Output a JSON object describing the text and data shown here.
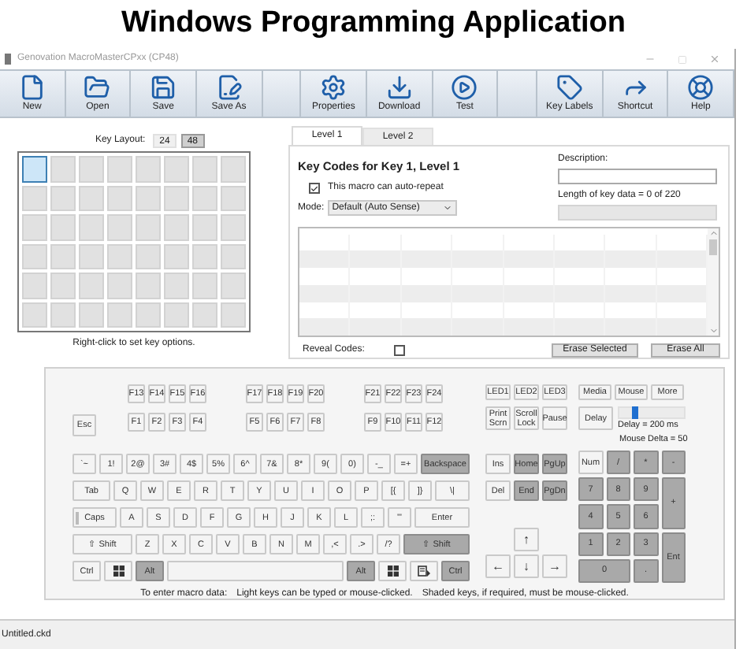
{
  "heading": "Windows Programming Application",
  "window": {
    "title": "Genovation MacroMasterCPxx (CP48)"
  },
  "toolbar": {
    "groups": [
      [
        {
          "kind": "new",
          "label": "New"
        },
        {
          "kind": "open",
          "label": "Open"
        },
        {
          "kind": "save",
          "label": "Save"
        },
        {
          "kind": "save_as",
          "label": "Save As"
        }
      ],
      [
        {
          "kind": "properties",
          "label": "Properties"
        },
        {
          "kind": "download",
          "label": "Download"
        },
        {
          "kind": "test",
          "label": "Test"
        }
      ],
      [
        {
          "kind": "key_labels",
          "label": "Key Labels"
        },
        {
          "kind": "shortcut",
          "label": "Shortcut"
        },
        {
          "kind": "help",
          "label": "Help"
        }
      ]
    ]
  },
  "key_layout": {
    "label": "Key Layout:",
    "options": [
      {
        "label": "24",
        "selected": false
      },
      {
        "label": "48",
        "selected": true
      }
    ]
  },
  "key_grid": {
    "rows": [
      [
        {
          "selected": true
        },
        {
          "selected": false
        },
        {
          "selected": false
        },
        {
          "selected": false
        },
        {
          "selected": false
        },
        {
          "selected": false
        },
        {
          "selected": false
        },
        {
          "selected": false
        }
      ],
      [
        {
          "selected": false
        },
        {
          "selected": false
        },
        {
          "selected": false
        },
        {
          "selected": false
        },
        {
          "selected": false
        },
        {
          "selected": false
        },
        {
          "selected": false
        },
        {
          "selected": false
        }
      ],
      [
        {
          "selected": false
        },
        {
          "selected": false
        },
        {
          "selected": false
        },
        {
          "selected": false
        },
        {
          "selected": false
        },
        {
          "selected": false
        },
        {
          "selected": false
        },
        {
          "selected": false
        }
      ],
      [
        {
          "selected": false
        },
        {
          "selected": false
        },
        {
          "selected": false
        },
        {
          "selected": false
        },
        {
          "selected": false
        },
        {
          "selected": false
        },
        {
          "selected": false
        },
        {
          "selected": false
        }
      ],
      [
        {
          "selected": false
        },
        {
          "selected": false
        },
        {
          "selected": false
        },
        {
          "selected": false
        },
        {
          "selected": false
        },
        {
          "selected": false
        },
        {
          "selected": false
        },
        {
          "selected": false
        }
      ],
      [
        {
          "selected": false
        },
        {
          "selected": false
        },
        {
          "selected": false
        },
        {
          "selected": false
        },
        {
          "selected": false
        },
        {
          "selected": false
        },
        {
          "selected": false
        },
        {
          "selected": false
        }
      ]
    ],
    "hint": "Right-click to set key options."
  },
  "tabs": [
    {
      "label": "Level 1",
      "selected": true
    },
    {
      "label": "Level 2",
      "selected": false
    }
  ],
  "key_codes": {
    "title": "Key Codes for Key 1, Level 1",
    "auto_repeat": {
      "label": "This macro can auto-repeat",
      "checked": true
    },
    "mode": {
      "label": "Mode:",
      "value": "Default (Auto Sense)"
    },
    "description": {
      "label": "Description:"
    },
    "length": "Length of key data = 0 of 220",
    "reveal_codes": {
      "label": "Reveal Codes:",
      "checked": false
    },
    "buttons": [
      "Erase Selected",
      "Erase All"
    ]
  },
  "keyboard": {
    "esc": {
      "label": "Esc",
      "shaded": false
    },
    "function_rows": [
      [
        [
          {
            "label": "F13",
            "shaded": false
          },
          {
            "label": "F14",
            "shaded": false
          },
          {
            "label": "F15",
            "shaded": false
          },
          {
            "label": "F16",
            "shaded": false
          }
        ],
        [
          {
            "label": "F17",
            "shaded": false
          },
          {
            "label": "F18",
            "shaded": false
          },
          {
            "label": "F19",
            "shaded": false
          },
          {
            "label": "F20",
            "shaded": false
          }
        ],
        [
          {
            "label": "F21",
            "shaded": false
          },
          {
            "label": "F22",
            "shaded": false
          },
          {
            "label": "F23",
            "shaded": false
          },
          {
            "label": "F24",
            "shaded": false
          }
        ]
      ],
      [
        [
          {
            "label": "F1",
            "shaded": false
          },
          {
            "label": "F2",
            "shaded": false
          },
          {
            "label": "F3",
            "shaded": false
          },
          {
            "label": "F4",
            "shaded": false
          }
        ],
        [
          {
            "label": "F5",
            "shaded": false
          },
          {
            "label": "F6",
            "shaded": false
          },
          {
            "label": "F7",
            "shaded": false
          },
          {
            "label": "F8",
            "shaded": false
          }
        ],
        [
          {
            "label": "F9",
            "shaded": false
          },
          {
            "label": "F10",
            "shaded": false
          },
          {
            "label": "F11",
            "shaded": false
          },
          {
            "label": "F12",
            "shaded": false
          }
        ]
      ]
    ],
    "main_rows": [
      [
        {
          "kind": "std",
          "label": "`~",
          "shaded": false
        },
        {
          "kind": "std",
          "label": "1!",
          "shaded": false
        },
        {
          "kind": "std",
          "label": "2@",
          "shaded": false
        },
        {
          "kind": "std",
          "label": "3#",
          "shaded": false
        },
        {
          "kind": "std",
          "label": "4$",
          "shaded": false
        },
        {
          "kind": "std",
          "label": "5%",
          "shaded": false
        },
        {
          "kind": "std",
          "label": "6^",
          "shaded": false
        },
        {
          "kind": "std",
          "label": "7&",
          "shaded": false
        },
        {
          "kind": "std",
          "label": "8*",
          "shaded": false
        },
        {
          "kind": "std",
          "label": "9(",
          "shaded": false
        },
        {
          "kind": "std",
          "label": "0)",
          "shaded": false
        },
        {
          "kind": "std",
          "label": "-_",
          "shaded": false
        },
        {
          "kind": "std",
          "label": "=+",
          "shaded": false
        },
        {
          "kind": "fill",
          "label": "Backspace",
          "shaded": true
        }
      ],
      [
        {
          "kind": "tab",
          "label": "Tab",
          "shaded": false
        },
        {
          "kind": "std",
          "label": "Q",
          "shaded": false
        },
        {
          "kind": "std",
          "label": "W",
          "shaded": false
        },
        {
          "kind": "std",
          "label": "E",
          "shaded": false
        },
        {
          "kind": "std",
          "label": "R",
          "shaded": false
        },
        {
          "kind": "std",
          "label": "T",
          "shaded": false
        },
        {
          "kind": "std",
          "label": "Y",
          "shaded": false
        },
        {
          "kind": "std",
          "label": "U",
          "shaded": false
        },
        {
          "kind": "std",
          "label": "I",
          "shaded": false
        },
        {
          "kind": "std",
          "label": "O",
          "shaded": false
        },
        {
          "kind": "std",
          "label": "P",
          "shaded": false
        },
        {
          "kind": "std",
          "label": "[{",
          "shaded": false
        },
        {
          "kind": "std",
          "label": "]}",
          "shaded": false
        },
        {
          "kind": "fill",
          "label": "\\|",
          "shaded": false
        }
      ],
      [
        {
          "kind": "caps",
          "label": "Caps",
          "shaded": false
        },
        {
          "kind": "std",
          "label": "A",
          "shaded": false
        },
        {
          "kind": "std",
          "label": "S",
          "shaded": false
        },
        {
          "kind": "std",
          "label": "D",
          "shaded": false
        },
        {
          "kind": "std",
          "label": "F",
          "shaded": false
        },
        {
          "kind": "std",
          "label": "G",
          "shaded": false
        },
        {
          "kind": "std",
          "label": "H",
          "shaded": false
        },
        {
          "kind": "std",
          "label": "J",
          "shaded": false
        },
        {
          "kind": "std",
          "label": "K",
          "shaded": false
        },
        {
          "kind": "std",
          "label": "L",
          "shaded": false
        },
        {
          "kind": "std",
          "label": ";:",
          "shaded": false
        },
        {
          "kind": "std",
          "label": "'\"",
          "shaded": false
        },
        {
          "kind": "fill",
          "label": "Enter",
          "shaded": false
        }
      ],
      [
        {
          "kind": "lshift",
          "label": "⇧ Shift",
          "shaded": false
        },
        {
          "kind": "std",
          "label": "Z",
          "shaded": false
        },
        {
          "kind": "std",
          "label": "X",
          "shaded": false
        },
        {
          "kind": "std",
          "label": "C",
          "shaded": false
        },
        {
          "kind": "std",
          "label": "V",
          "shaded": false
        },
        {
          "kind": "std",
          "label": "B",
          "shaded": false
        },
        {
          "kind": "std",
          "label": "N",
          "shaded": false
        },
        {
          "kind": "std",
          "label": "M",
          "shaded": false
        },
        {
          "kind": "std",
          "label": ",<",
          "shaded": false
        },
        {
          "kind": "std",
          "label": ".>",
          "shaded": false
        },
        {
          "kind": "std",
          "label": "/?",
          "shaded": false
        },
        {
          "kind": "fill",
          "label": "⇧ Shift",
          "shaded": true
        }
      ],
      [
        {
          "kind": "mod",
          "label": "Ctrl",
          "shaded": false
        },
        {
          "kind": "win",
          "shaded": false
        },
        {
          "kind": "mod",
          "label": "Alt",
          "shaded": true
        },
        {
          "kind": "space",
          "shaded": false
        },
        {
          "kind": "mod",
          "label": "Alt",
          "shaded": true
        },
        {
          "kind": "win",
          "shaded": false
        },
        {
          "kind": "menu",
          "shaded": false
        },
        {
          "kind": "mod",
          "label": "Ctrl",
          "shaded": true
        }
      ]
    ],
    "leds": [
      {
        "label": "LED1",
        "shaded": false
      },
      {
        "label": "LED2",
        "shaded": false
      },
      {
        "label": "LED3",
        "shaded": false
      }
    ],
    "system_keys": [
      {
        "label": "Print Scrn",
        "shaded": false
      },
      {
        "label": "Scroll Lock",
        "shaded": false
      },
      {
        "label": "Pause",
        "shaded": false
      }
    ],
    "nav_keys": [
      {
        "label": "Ins",
        "shaded": false
      },
      {
        "label": "Home",
        "shaded": true
      },
      {
        "label": "PgUp",
        "shaded": true
      },
      {
        "label": "Del",
        "shaded": false
      },
      {
        "label": "End",
        "shaded": true
      },
      {
        "label": "PgDn",
        "shaded": true
      }
    ],
    "arrow_keys": [
      {
        "label": "↑",
        "shaded": false
      },
      {
        "label": "←",
        "shaded": false
      },
      {
        "label": "↓",
        "shaded": false
      },
      {
        "label": "→",
        "shaded": false
      }
    ],
    "mode_buttons": [
      "Media",
      "Mouse",
      "More"
    ],
    "delay": {
      "label": "Delay",
      "level": 0.25,
      "reading": "Delay = 200 ms",
      "mouse_reading": "Mouse Delta = 50"
    },
    "numpad": [
      {
        "kind": "std",
        "label": "Num",
        "shaded": false
      },
      {
        "kind": "std",
        "label": "/",
        "shaded": true
      },
      {
        "kind": "std",
        "label": "*",
        "shaded": true
      },
      {
        "kind": "std",
        "label": "-",
        "shaded": true
      },
      {
        "kind": "std",
        "label": "7",
        "shaded": true
      },
      {
        "kind": "std",
        "label": "8",
        "shaded": true
      },
      {
        "kind": "std",
        "label": "9",
        "shaded": true
      },
      {
        "kind": "tall",
        "label": "+",
        "shaded": true
      },
      {
        "kind": "std",
        "label": "4",
        "shaded": true
      },
      {
        "kind": "std",
        "label": "5",
        "shaded": true
      },
      {
        "kind": "std",
        "label": "6",
        "shaded": true
      },
      {
        "kind": "std",
        "label": "1",
        "shaded": true
      },
      {
        "kind": "std",
        "label": "2",
        "shaded": true
      },
      {
        "kind": "std",
        "label": "3",
        "shaded": true
      },
      {
        "kind": "tall",
        "label": "Ent",
        "shaded": true
      },
      {
        "kind": "wide",
        "label": "0",
        "shaded": true
      },
      {
        "kind": "std",
        "label": ".",
        "shaded": true
      }
    ],
    "hints": [
      "To enter macro data:",
      "Light keys can be typed or mouse-clicked.",
      "Shaded keys, if required, must be mouse-clicked."
    ]
  },
  "status_bar": {
    "file": "Untitled.ckd"
  }
}
